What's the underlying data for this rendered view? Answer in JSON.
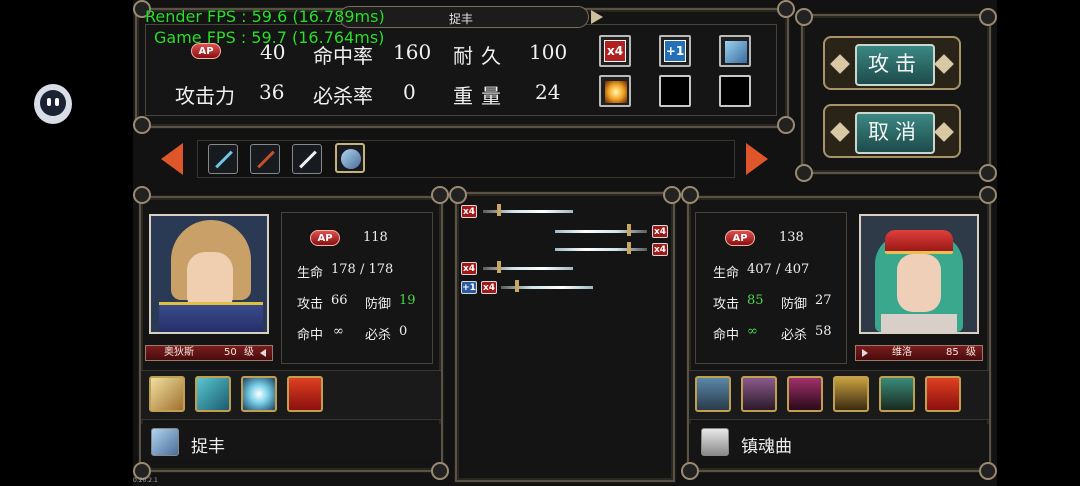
{
  "overlay": {
    "render_fps": "Render FPS : 59.6 (16.789ms)",
    "game_fps": "Game FPS : 59.7 (16.764ms)",
    "version": "0.20.2.1"
  },
  "weapon_panel": {
    "title": "捉丰",
    "ap_label": "AP",
    "ap_value": "40",
    "hit_label": "命中率",
    "hit_value": "160",
    "durability_label": "耐久",
    "durability_value": "100",
    "attack_label": "攻击力",
    "attack_value": "36",
    "crit_label": "必杀率",
    "crit_value": "0",
    "weight_label": "重量",
    "weight_value": "24",
    "badges": [
      "x4",
      "+1"
    ]
  },
  "buttons": {
    "attack": "攻击",
    "cancel": "取消"
  },
  "left_unit": {
    "name": "奥狄斯",
    "level": "50",
    "level_suffix": "级",
    "ap_label": "AP",
    "ap_value": "118",
    "hp_label": "生命",
    "hp_value": "178 / 178",
    "atk_label": "攻击",
    "atk_value": "66",
    "def_label": "防御",
    "def_value": "19",
    "hit_label": "命中",
    "hit_value": "∞",
    "crit_label": "必杀",
    "crit_value": "0",
    "weapon_name": "捉丰"
  },
  "right_unit": {
    "name": "维洛",
    "level": "85",
    "level_suffix": "级",
    "ap_label": "AP",
    "ap_value": "138",
    "hp_label": "生命",
    "hp_value": "407 / 407",
    "atk_label": "攻击",
    "atk_value": "85",
    "def_label": "防御",
    "def_value": "27",
    "hit_label": "命中",
    "hit_value": "∞",
    "crit_label": "必杀",
    "crit_value": "58",
    "weapon_name": "镇魂曲"
  },
  "battle_log": {
    "tag_x4": "x4",
    "tag_plus1": "+1"
  },
  "colors": {
    "accent_green": "#4cd84c",
    "button_teal": "#2e6f6c",
    "arrow_orange": "#e0562b",
    "fps_green": "#2ae02a"
  }
}
